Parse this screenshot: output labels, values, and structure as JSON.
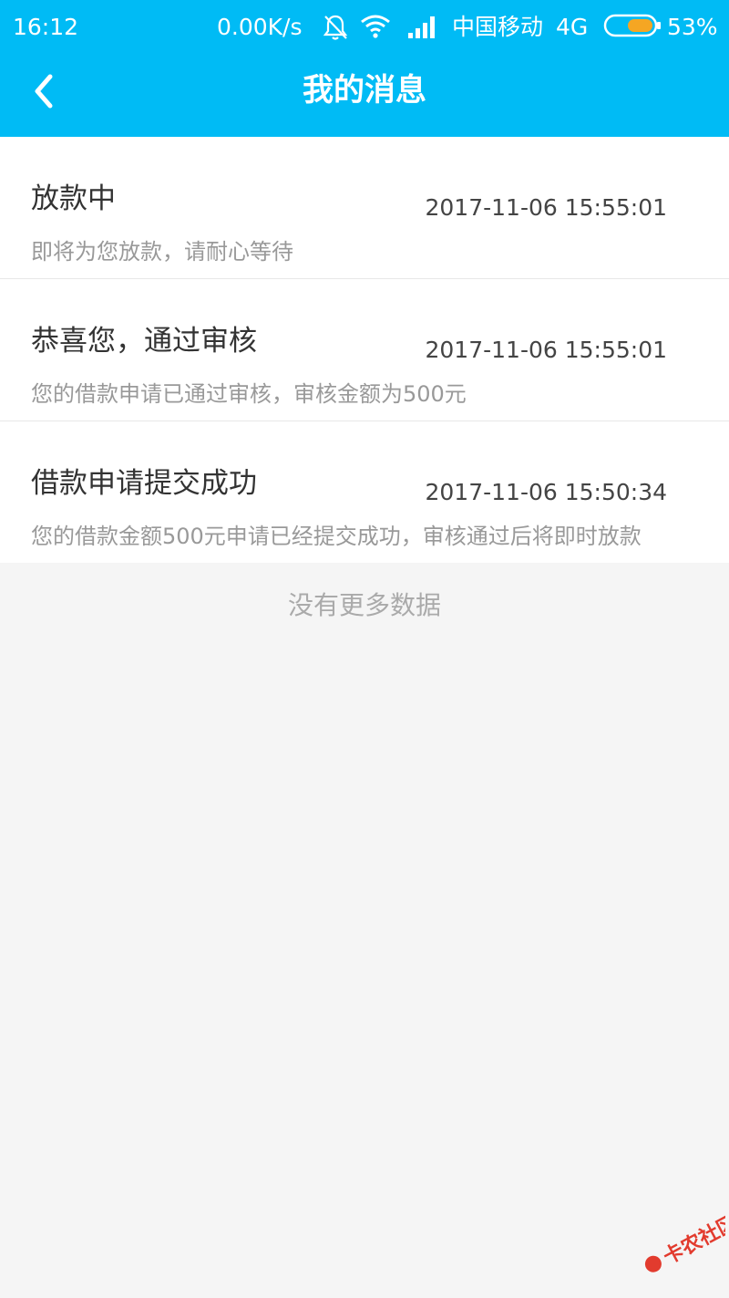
{
  "status_bar": {
    "time": "16:12",
    "speed": "0.00K/s",
    "carrier": "中国移动",
    "network": "4G",
    "battery": "53%",
    "bell_icon": "bell-muted-icon",
    "wifi_icon": "wifi-icon",
    "signal_icon": "signal-icon",
    "battery_icon": "battery-icon"
  },
  "header": {
    "title": "我的消息",
    "back_icon": "back-arrow-icon"
  },
  "messages": [
    {
      "title": "放款中",
      "time": "2017-11-06 15:55:01",
      "body": "即将为您放款，请耐心等待"
    },
    {
      "title": "恭喜您，通过审核",
      "time": "2017-11-06 15:55:01",
      "body": "您的借款申请已通过审核，审核金额为500元"
    },
    {
      "title": "借款申请提交成功",
      "time": "2017-11-06 15:50:34",
      "body": "您的借款金额500元申请已经提交成功，审核通过后将即时放款"
    }
  ],
  "footer_note": "没有更多数据",
  "watermark": {
    "text": "卡农社区"
  },
  "colors": {
    "header_bg": "#00bbf5",
    "page_bg": "#f5f5f5",
    "battery_fill": "#f5a623"
  }
}
